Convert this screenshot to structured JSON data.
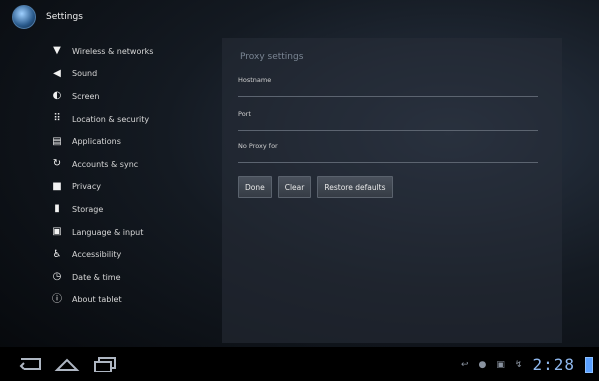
{
  "app": {
    "title": "Settings",
    "icon": "settings-app-icon"
  },
  "sidebar": {
    "items": [
      {
        "label": "Wireless & networks",
        "icon": "wifi-icon"
      },
      {
        "label": "Sound",
        "icon": "speaker-icon"
      },
      {
        "label": "Screen",
        "icon": "brightness-icon"
      },
      {
        "label": "Location & security",
        "icon": "grid-lock-icon"
      },
      {
        "label": "Applications",
        "icon": "applications-icon"
      },
      {
        "label": "Accounts & sync",
        "icon": "sync-icon"
      },
      {
        "label": "Privacy",
        "icon": "privacy-icon"
      },
      {
        "label": "Storage",
        "icon": "storage-icon"
      },
      {
        "label": "Language & input",
        "icon": "language-icon"
      },
      {
        "label": "Accessibility",
        "icon": "accessibility-icon"
      },
      {
        "label": "Date & time",
        "icon": "clock-icon"
      },
      {
        "label": "About tablet",
        "icon": "info-icon"
      }
    ]
  },
  "proxy": {
    "title": "Proxy settings",
    "hostname_label": "Hostname",
    "hostname_value": "",
    "port_label": "Port",
    "port_value": "",
    "noproxy_label": "No Proxy for",
    "noproxy_value": "",
    "buttons": {
      "done": "Done",
      "clear": "Clear",
      "restore": "Restore defaults"
    }
  },
  "status": {
    "time": "2:28"
  },
  "colors": {
    "accent": "#5aa0ff",
    "background": "#0c1118"
  }
}
